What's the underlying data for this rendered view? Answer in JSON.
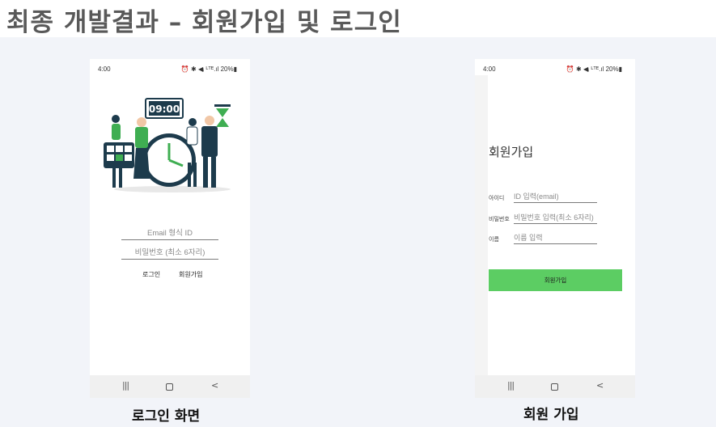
{
  "slide": {
    "title": "최종 개발결과 – 회원가입 및 로그인"
  },
  "login_screen": {
    "status_time": "4:00",
    "status_icons": "⏰ ✱ ◀ᵢ ᴸᵀᴱ.ıl 20%▮",
    "email_placeholder": "Email 형식 ID",
    "password_placeholder": "비밀번호 (최소 6자리)",
    "login_label": "로그인",
    "signup_label": "회원가입",
    "illustration_clock": "09:00",
    "caption": "로그인 화면"
  },
  "signup_screen": {
    "status_time": "4:00",
    "status_icons": "⏰ ✱ ◀ᵢ ᴸᵀᴱ.ıl 20%▮",
    "title": "회원가입",
    "fields": [
      {
        "label": "아이디",
        "placeholder": "ID 입력(email)"
      },
      {
        "label": "비밀번호",
        "placeholder": "비밀번호 입력(최소 6자리)"
      },
      {
        "label": "이름",
        "placeholder": "이름 입력"
      }
    ],
    "submit_label": "회원가입",
    "caption": "회원 가입"
  },
  "nav": {
    "recent": "|||",
    "back": "<"
  },
  "colors": {
    "accent_green": "#5ccd63",
    "illustration_green": "#3fae52",
    "illustration_navy": "#1d3b4c"
  }
}
